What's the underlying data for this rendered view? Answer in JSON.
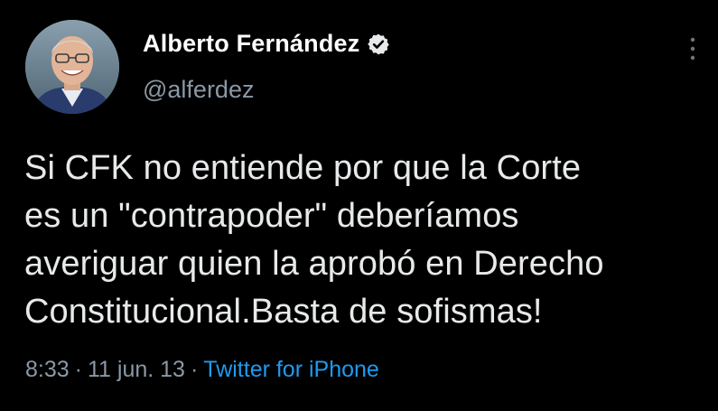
{
  "author": {
    "display_name": "Alberto Fernández",
    "handle": "@alferdez",
    "verified": true,
    "avatar_icon": "profile-photo"
  },
  "tweet": {
    "lines": [
      "Si CFK no entiende por que la Corte",
      "es un \"contrapoder\" deberíamos",
      "averiguar quien la aprobó en Derecho",
      "Constitucional.Basta de sofismas!"
    ]
  },
  "meta": {
    "time": "8:33",
    "separator": "·",
    "date": "11 jun. 13",
    "source": "Twitter for iPhone"
  },
  "icons": {
    "verified": "verified-badge-icon",
    "more": "more-options-icon"
  },
  "colors": {
    "background": "#000000",
    "text": "#e7e9ea",
    "secondary": "#8b98a5",
    "link": "#1d9bf0"
  }
}
